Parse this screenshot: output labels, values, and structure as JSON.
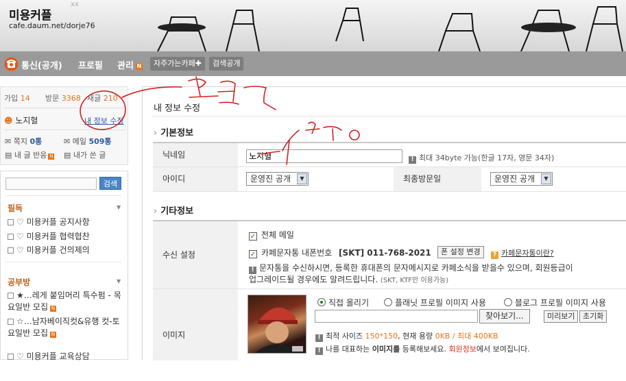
{
  "cafe": {
    "title": "미용커플",
    "url": "cafe.daum.net/dorje76"
  },
  "menu": {
    "items": [
      {
        "label": "통신(공개)"
      },
      {
        "label": "프로필"
      },
      {
        "label": "관리",
        "badge": "N"
      }
    ],
    "favorites_label": "자주가는카페✚",
    "search_public_label": "검색공개"
  },
  "sidebar": {
    "stats": [
      {
        "label": "가입",
        "value": "14"
      },
      {
        "label": "방문",
        "value": "3368"
      },
      {
        "label": "새글",
        "value": "210"
      }
    ],
    "user_name": "노지혈",
    "edit_info_link": "내 정보 수정",
    "note": {
      "label": "쪽지",
      "value": "0통"
    },
    "mail": {
      "label": "메일",
      "value": "509통"
    },
    "my_replies": "내 글 반응",
    "my_posts": "내가 쓴 글",
    "search_button": "검색",
    "categories": [
      {
        "name": "필독",
        "boards": [
          "♡ 미용커플 공지사항",
          "♡ 미용커플 협력협찬",
          "♡ 미용커플 건의제의"
        ]
      },
      {
        "name": "공부방",
        "boards": [
          "★…레게 붙임머리 특수펌 - 목요일반 모집",
          "☆…남자베이직컷&유행 컷-토요일반 모집",
          "♡ 미용커플 교육상담"
        ]
      }
    ]
  },
  "main": {
    "page_title": "내 정보 수정",
    "basic_section": "기본정보",
    "nickname_label": "닉네임",
    "nickname_value": "노지혈",
    "nickname_hint": "최대 34byte 가능(한글 17자, 영문 34자)",
    "id_label": "아이디",
    "id_visibility": "운영진 공개",
    "last_visit_label": "최종방문일",
    "last_visit_visibility": "운영진 공개",
    "other_section": "기타정보",
    "receive_label": "수신 설정",
    "all_mail": "전체 메일",
    "sms_label": "카페문자통 내폰번호",
    "sms_number": "[SKT] 011-768-2021",
    "phone_change_button": "폰 설정 변경",
    "sms_help_link": "카페문자통이란?",
    "sms_notice_1": "문자통을 수신하시면, 등록한 휴대폰의 문자메시지로 카페소식을 받을수 있으며, 회원등급이",
    "sms_notice_2": "업그레이드될 경우에도 알려드립니다.",
    "sms_notice_carrier": "(SKT, KTF만 이용가능)",
    "image_label": "이미지",
    "image_options": [
      "직접 올리기",
      "플래닛 프로필 이미지 사용",
      "블로그 프로필 이미지 사용"
    ],
    "browse_button": "찾아보기...",
    "preview_button": "미리보기",
    "reset_button": "초기화",
    "size_note_prefix": "최적 사이즈",
    "size_note_size": "150*150",
    "size_note_mid": ", 현재 용량",
    "size_note_usage": "0KB / 최대 400KB",
    "rep_note_prefix": "나를 대표하는",
    "rep_note_bold": "이미지를",
    "rep_note_mid": "등록해보세요.",
    "rep_note_link": "회원정보",
    "rep_note_suffix": "에서 보여집니다."
  },
  "annotations": {
    "click_note": "클릭",
    "edit_note": "수정"
  },
  "colors": {
    "accent": "#e8731a",
    "menubar": "#9a9a9a",
    "link": "#2d5aa3",
    "scribble": "#d42020"
  }
}
